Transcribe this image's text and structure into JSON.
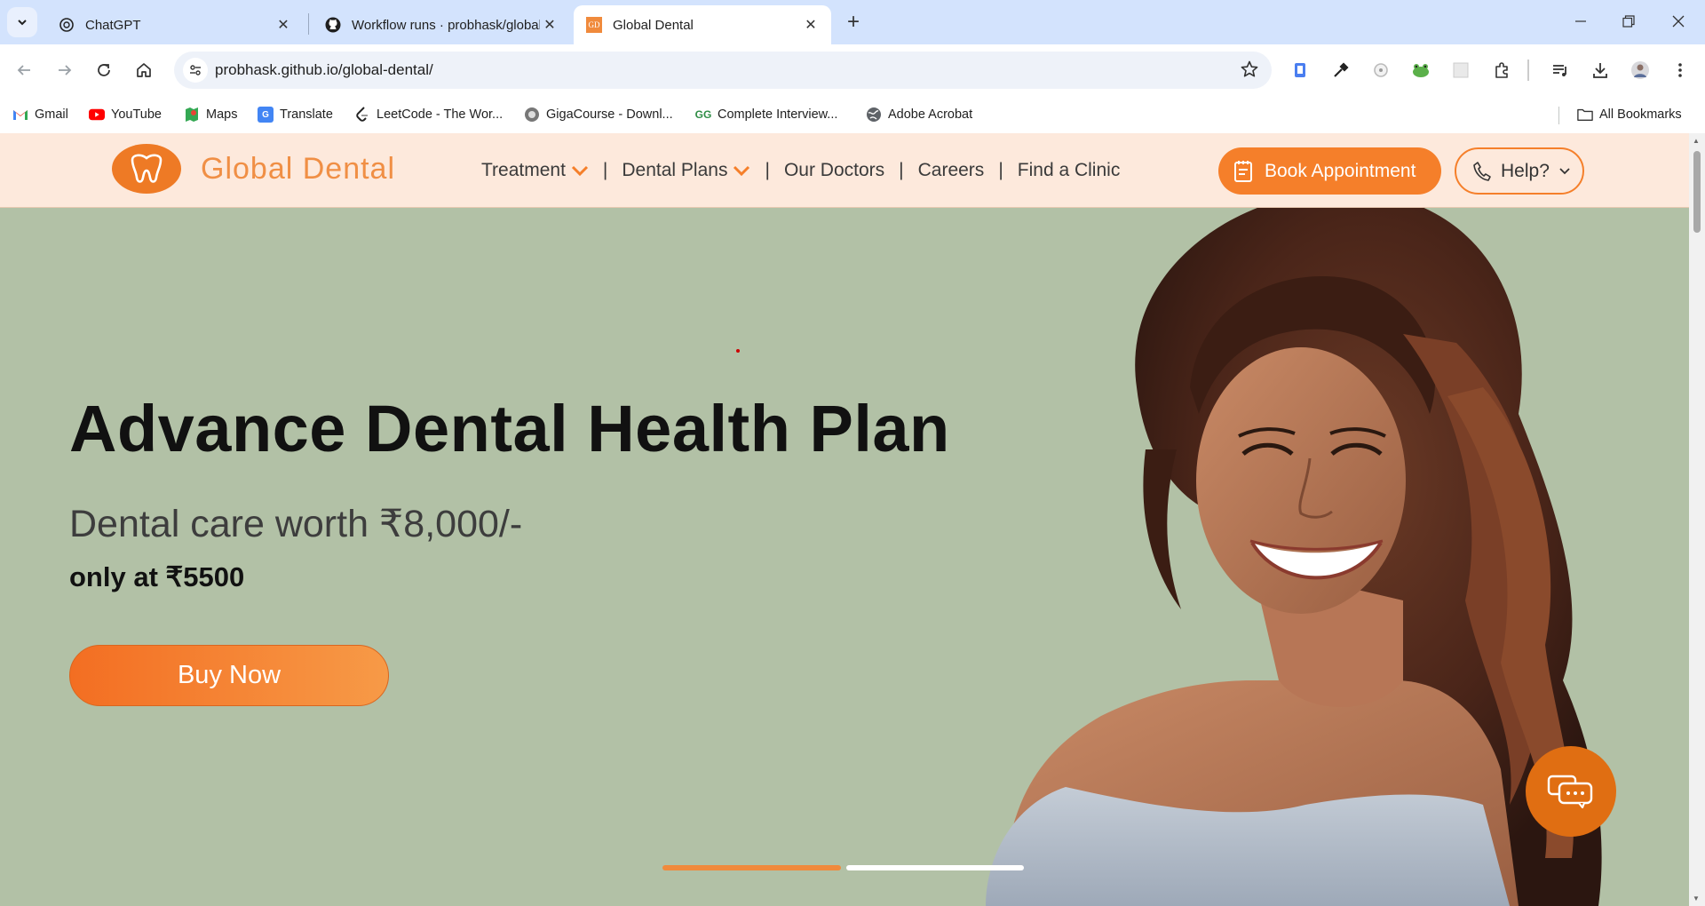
{
  "browser": {
    "tabs": [
      {
        "title": "ChatGPT",
        "active": false
      },
      {
        "title": "Workflow runs · probhask/global-dental",
        "active": false
      },
      {
        "title": "Global Dental",
        "active": true,
        "favicon_text": "GD"
      }
    ],
    "url": "probhask.github.io/global-dental/",
    "bookmarks": [
      {
        "label": "Gmail",
        "icon": "gmail-icon"
      },
      {
        "label": "YouTube",
        "icon": "youtube-icon"
      },
      {
        "label": "Maps",
        "icon": "maps-icon"
      },
      {
        "label": "Translate",
        "icon": "translate-icon"
      },
      {
        "label": "LeetCode - The Wor...",
        "icon": "leetcode-icon"
      },
      {
        "label": "GigaCourse - Downl...",
        "icon": "gigacourse-icon"
      },
      {
        "label": "Complete Interview...",
        "icon": "gfg-icon"
      },
      {
        "label": "Adobe Acrobat",
        "icon": "globe-icon"
      }
    ],
    "all_bookmarks": "All Bookmarks"
  },
  "site": {
    "brand": "Global Dental",
    "nav": [
      {
        "label": "Treatment",
        "has_dropdown": true
      },
      {
        "label": "Dental Plans",
        "has_dropdown": true
      },
      {
        "label": "Our Doctors",
        "has_dropdown": false
      },
      {
        "label": "Careers",
        "has_dropdown": false
      },
      {
        "label": "Find a Clinic",
        "has_dropdown": false
      }
    ],
    "nav_separator": "|",
    "book_appointment": "Book Appointment",
    "help": "Help?",
    "accent_color": "#f57f2a"
  },
  "hero": {
    "title": "Advance Dental Health Plan",
    "subtitle": "Dental care worth ₹8,000/-",
    "price": "only at ₹5500",
    "cta": "Buy Now",
    "slides_total": 2,
    "active_slide": 1
  }
}
